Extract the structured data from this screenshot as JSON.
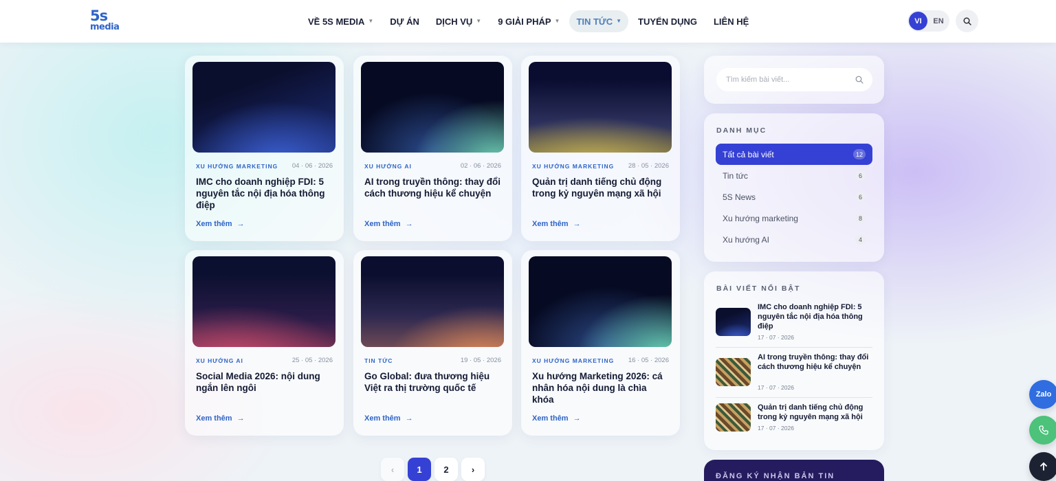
{
  "header": {
    "logo_top": "5s",
    "logo_bottom": "media",
    "nav": [
      {
        "label": "VỀ 5S MEDIA",
        "has_dropdown": true
      },
      {
        "label": "DỰ ÁN",
        "has_dropdown": false
      },
      {
        "label": "DỊCH VỤ",
        "has_dropdown": true
      },
      {
        "label": "9 GIẢI PHÁP",
        "has_dropdown": true
      },
      {
        "label": "TIN TỨC",
        "has_dropdown": true,
        "active": true
      },
      {
        "label": "TUYỂN DỤNG",
        "has_dropdown": false
      },
      {
        "label": "LIÊN HỆ",
        "has_dropdown": false
      }
    ],
    "lang_vi": "VI",
    "lang_en": "EN",
    "search_icon": "search-icon"
  },
  "cards": [
    {
      "category": "XU HƯỚNG MARKETING",
      "date": "04 · 06 · 2026",
      "title": "IMC cho doanh nghiệp FDI: 5 nguyên tắc nội địa hóa thông điệp",
      "more": "Xem thêm"
    },
    {
      "category": "XU HƯỚNG AI",
      "date": "02 · 06 · 2026",
      "title": "AI trong truyền thông: thay đổi cách thương hiệu kể chuyện",
      "more": "Xem thêm"
    },
    {
      "category": "XU HƯỚNG MARKETING",
      "date": "28 · 05 · 2026",
      "title": "Quản trị danh tiếng chủ động trong kỷ nguyên mạng xã hội",
      "more": "Xem thêm"
    },
    {
      "category": "XU HƯỚNG AI",
      "date": "25 · 05 · 2026",
      "title": "Social Media 2026: nội dung ngắn lên ngôi",
      "more": "Xem thêm"
    },
    {
      "category": "TIN TỨC",
      "date": "19 · 05 · 2026",
      "title": "Go Global: đưa thương hiệu Việt ra thị trường quốc tế",
      "more": "Xem thêm"
    },
    {
      "category": "XU HƯỚNG MARKETING",
      "date": "16 · 05 · 2026",
      "title": "Xu hướng Marketing 2026: cá nhân hóa nội dung là chìa khóa",
      "more": "Xem thêm"
    }
  ],
  "pagination": {
    "prev": "‹",
    "pages": [
      "1",
      "2"
    ],
    "current": "1",
    "next": "›"
  },
  "sidebar": {
    "search_placeholder": "Tìm kiếm bài viết...",
    "categories_heading": "DANH MỤC",
    "categories": [
      {
        "label": "Tất cả bài viết",
        "count": "12",
        "active": true
      },
      {
        "label": "Tin tức",
        "count": "6"
      },
      {
        "label": "5S News",
        "count": "6"
      },
      {
        "label": "Xu hướng marketing",
        "count": "8"
      },
      {
        "label": "Xu hướng AI",
        "count": "4"
      }
    ],
    "featured_heading": "BÀI VIẾT NỔI BẬT",
    "featured": [
      {
        "title": "IMC cho doanh nghiệp FDI: 5 nguyên tắc nội địa hóa thông điệp",
        "date": "17 · 07 · 2026"
      },
      {
        "title": "AI trong truyền thông: thay đổi cách thương hiệu kể chuyện",
        "date": "17 · 07 · 2026"
      },
      {
        "title": "Quản trị danh tiếng chủ động trong kỷ nguyên mạng xã hội",
        "date": "17 · 07 · 2026"
      }
    ],
    "newsletter_heading": "ĐĂNG KÝ NHẬN BẢN TIN"
  },
  "floating": {
    "zalo": "Zalo",
    "phone_icon": "phone-icon",
    "top_icon": "arrow-up-icon"
  },
  "colors": {
    "accent": "#3541d4",
    "link": "#2f64c8",
    "newsletter_bg": "#251c5f"
  }
}
